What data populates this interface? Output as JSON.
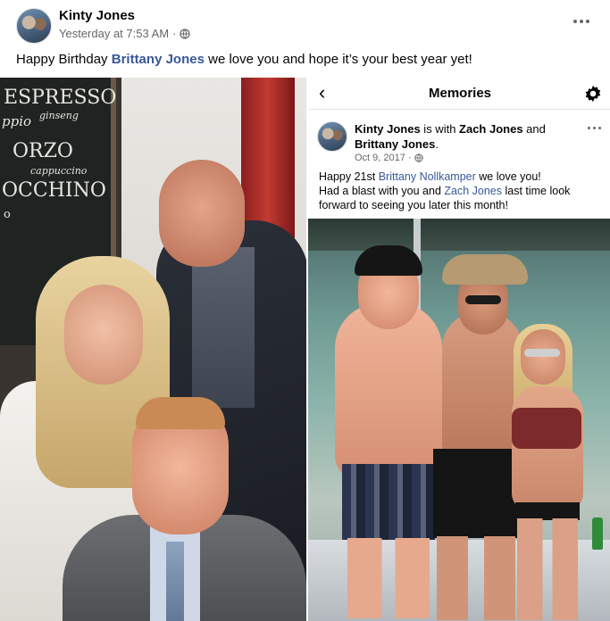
{
  "post": {
    "author": "Kinty Jones",
    "timestamp": "Yesterday at 7:53 AM",
    "separator": "·",
    "privacy_icon": "globe-icon",
    "more_icon": "more-options-icon",
    "text_before": "Happy Birthday ",
    "mention": "Brittany Jones",
    "text_after": " we love you and hope it’s your best year yet!"
  },
  "photo_left": {
    "chalkboard_words": [
      "ESPRESSO",
      "ppio",
      "ginseng",
      "ORZO",
      "cappuccino",
      "OCCHINO",
      "o"
    ]
  },
  "memories": {
    "back_icon": "chevron-left-icon",
    "back_glyph": "‹",
    "title": "Memories",
    "settings_icon": "gear-icon",
    "inner_post": {
      "author": "Kinty Jones",
      "with_text": " is with ",
      "tagged_1": "Zach Jones",
      "and_text": " and ",
      "tagged_2": "Brittany Jones",
      "period": ".",
      "date": "Oct 9, 2017",
      "separator": "·",
      "text_1": "Happy 21st ",
      "link_1": "Brittany Nollkamper",
      "text_2": " we love you!",
      "text_3": "Had a blast with you and ",
      "link_2": "Zach Jones",
      "text_4": " last time look forward to seeing you later this month!"
    }
  },
  "colors": {
    "link": "#385898",
    "meta": "#65676b",
    "text": "#050505"
  }
}
